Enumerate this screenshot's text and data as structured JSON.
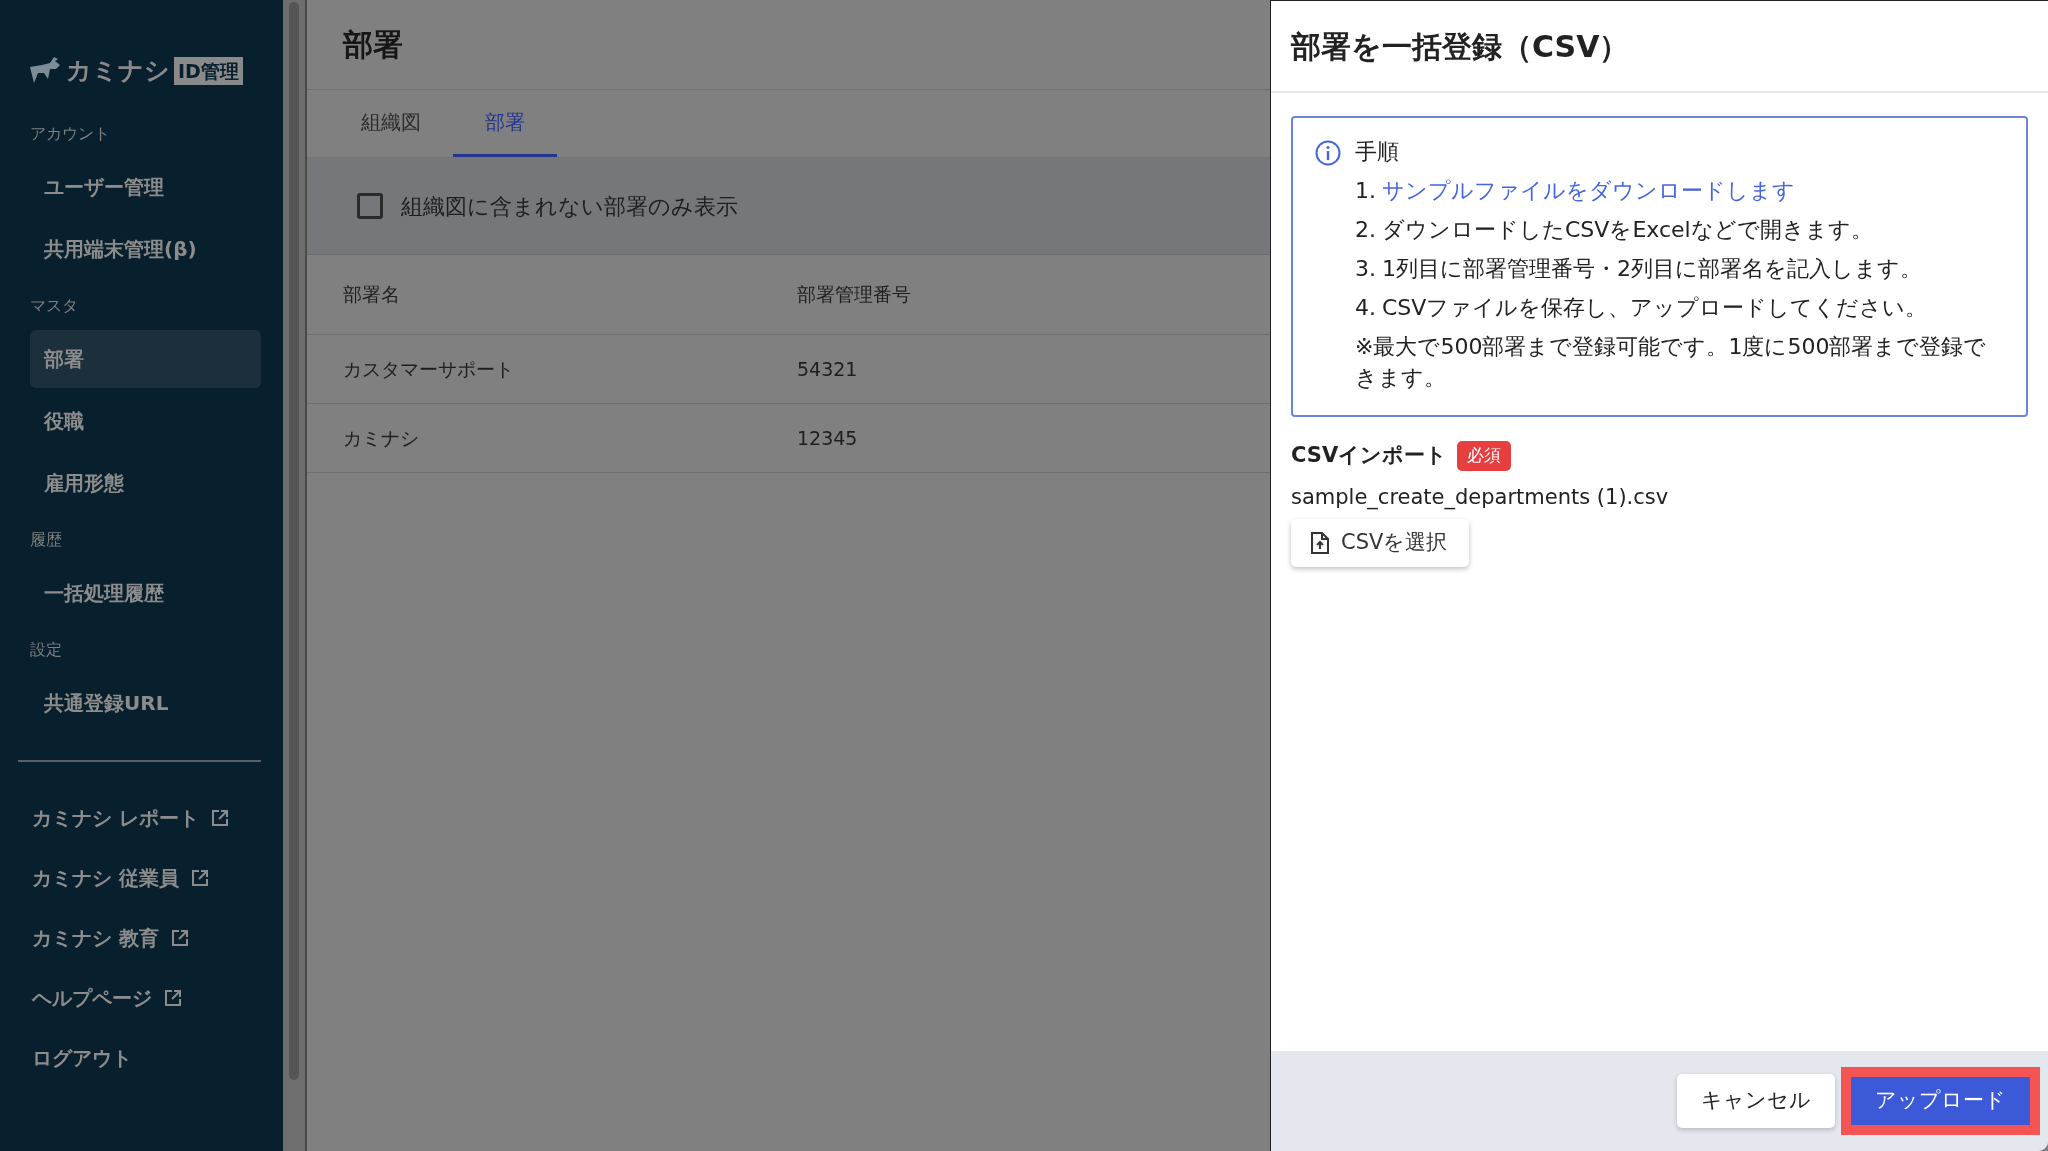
{
  "sidebar": {
    "logo_text": "カミナシ",
    "logo_badge": "ID管理",
    "sections": [
      {
        "heading": "アカウント",
        "items": [
          {
            "label": "ユーザー管理",
            "selected": false
          },
          {
            "label": "共用端末管理(β)",
            "selected": false
          }
        ]
      },
      {
        "heading": "マスタ",
        "items": [
          {
            "label": "部署",
            "selected": true
          },
          {
            "label": "役職",
            "selected": false
          },
          {
            "label": "雇用形態",
            "selected": false
          }
        ]
      },
      {
        "heading": "履歴",
        "items": [
          {
            "label": "一括処理履歴",
            "selected": false
          }
        ]
      },
      {
        "heading": "設定",
        "items": [
          {
            "label": "共通登録URL",
            "selected": false
          }
        ]
      }
    ],
    "links": [
      {
        "label": "カミナシ レポート",
        "external": true
      },
      {
        "label": "カミナシ 従業員",
        "external": true
      },
      {
        "label": "カミナシ 教育",
        "external": true
      },
      {
        "label": "ヘルプページ",
        "external": true
      },
      {
        "label": "ログアウト",
        "external": false
      }
    ]
  },
  "page": {
    "title": "部署",
    "tabs": [
      {
        "label": "組織図",
        "selected": false
      },
      {
        "label": "部署",
        "selected": true
      }
    ],
    "filter": {
      "label": "組織図に含まれない部署のみ表示",
      "checked": false
    },
    "table": {
      "columns": [
        "部署名",
        "部署管理番号"
      ],
      "rows": [
        [
          "カスタマーサポート",
          "54321"
        ],
        [
          "カミナシ",
          "12345"
        ]
      ]
    }
  },
  "dialog": {
    "title": "部署を一括登録（CSV）",
    "info": {
      "heading": "手順",
      "steps": [
        {
          "number": "1.",
          "text": "サンプルファイルをダウンロードします",
          "kind": "link"
        },
        {
          "number": "2.",
          "text": "ダウンロードしたCSVをExcelなどで開きます。",
          "kind": "text"
        },
        {
          "number": "3.",
          "text": "1列目に部署管理番号・2列目に部署名を記入します。",
          "kind": "text"
        },
        {
          "number": "4.",
          "text": "CSVファイルを保存し、アップロードしてください。",
          "kind": "text"
        }
      ],
      "note": "※最大で500部署まで登録可能です。1度に500部署まで登録できます。"
    },
    "import": {
      "label": "CSVインポート",
      "badge": "必須",
      "file_name": "sample_create_departments (1).csv",
      "select_button": "CSVを選択"
    },
    "buttons": [
      {
        "label": "キャンセル",
        "kind": "secondary",
        "highlighted": false
      },
      {
        "label": "アップロード",
        "kind": "primary",
        "highlighted": true
      }
    ]
  }
}
